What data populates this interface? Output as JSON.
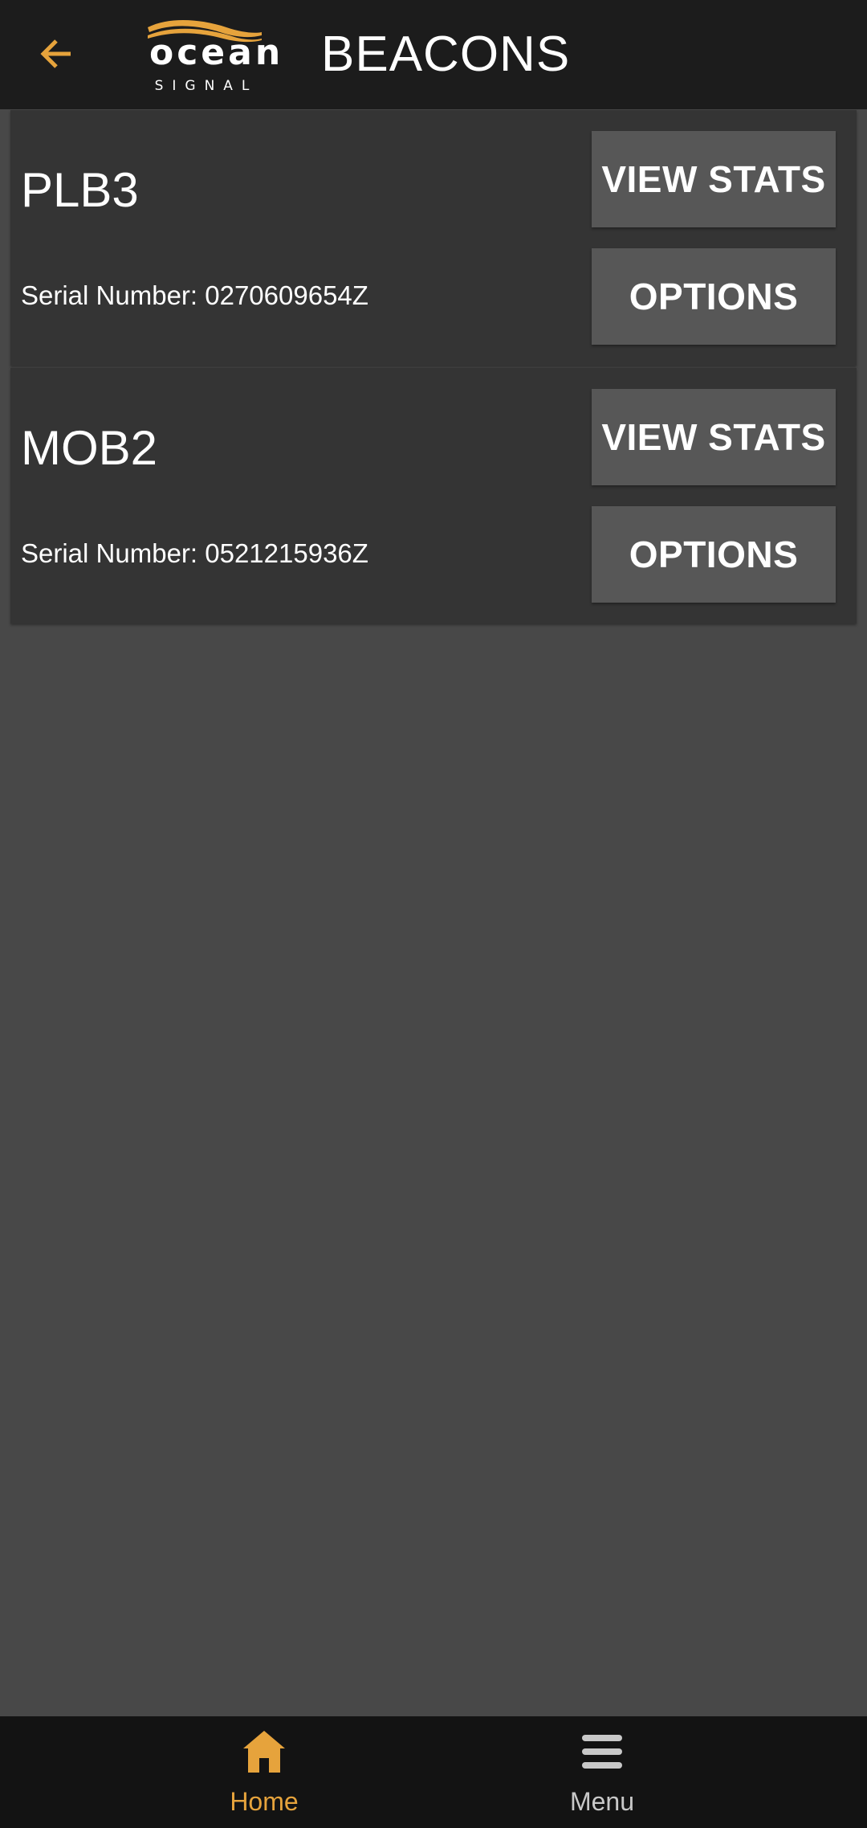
{
  "header": {
    "back_icon": "arrow-left-icon",
    "logo_word": "ocean",
    "logo_sub": "SIGNAL",
    "title": "BEACONS"
  },
  "beacons": [
    {
      "name": "PLB3",
      "serial": "Serial Number: 0270609654Z",
      "view_stats_label": "VIEW STATS",
      "options_label": "OPTIONS"
    },
    {
      "name": "MOB2",
      "serial": "Serial Number: 0521215936Z",
      "view_stats_label": "VIEW STATS",
      "options_label": "OPTIONS"
    }
  ],
  "bottom_nav": {
    "items": [
      {
        "label": "Home",
        "icon": "home-icon",
        "active": true
      },
      {
        "label": "Menu",
        "icon": "menu-icon",
        "active": false
      }
    ]
  },
  "colors": {
    "accent": "#e6a33c",
    "app_bar": "#1c1c1c",
    "background": "#484848",
    "card": "#343434",
    "button": "#575757",
    "bottom_nav": "#131313"
  }
}
